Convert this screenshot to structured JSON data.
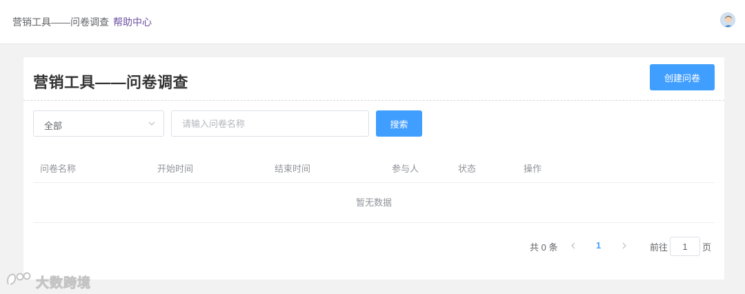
{
  "header": {
    "breadcrumb": "营销工具——问卷调查",
    "help_link": "帮助中心"
  },
  "page": {
    "title": "营销工具——问卷调查",
    "create_button": "创建问卷"
  },
  "filters": {
    "status_select_value": "全部",
    "search_placeholder": "请输入问卷名称",
    "search_button": "搜索"
  },
  "table": {
    "columns": [
      "问卷名称",
      "开始时间",
      "结束时间",
      "参与人",
      "状态",
      "操作"
    ],
    "empty_text": "暂无数据"
  },
  "pagination": {
    "total_text": "共 0 条",
    "current_page": "1",
    "goto_label": "前往",
    "goto_value": "1",
    "page_suffix": "页"
  },
  "watermark": {
    "text": "大数跨境"
  },
  "icons": {
    "select_arrow": "chevron-down-icon",
    "prev": "chevron-left-icon",
    "next": "chevron-right-icon",
    "avatar": "user-avatar-icon"
  },
  "colors": {
    "primary": "#409eff",
    "help_link": "#6b4fa0",
    "page_bg": "#f2f2f2"
  }
}
